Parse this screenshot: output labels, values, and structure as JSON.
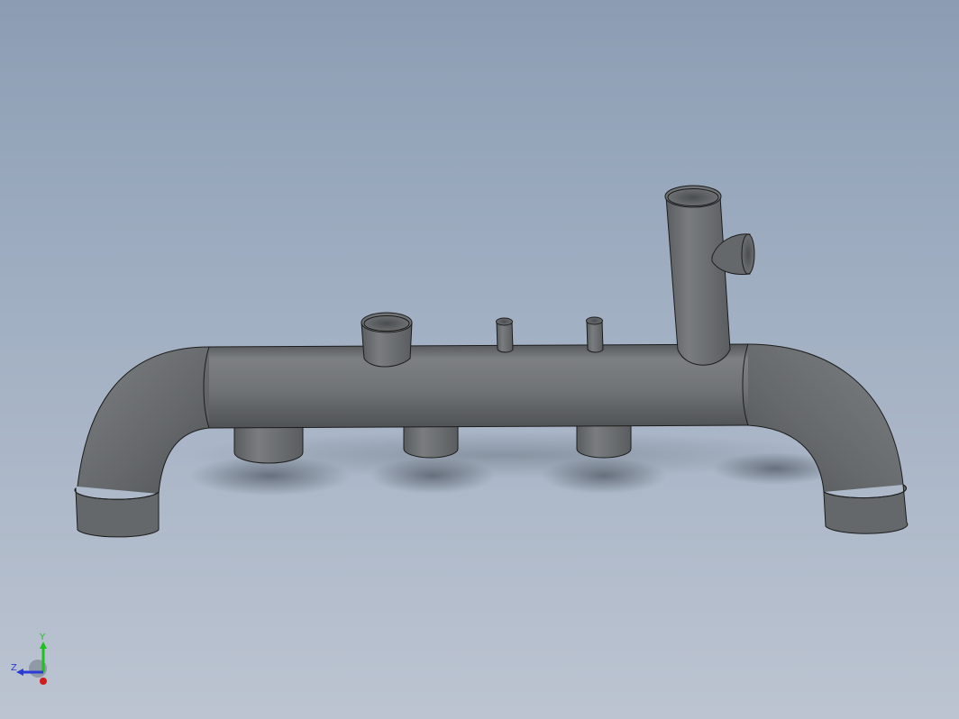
{
  "viewport": {
    "background_top": "#8c9db3",
    "background_bottom": "#bcc4d1"
  },
  "model": {
    "pipe_color": "#6b6e70",
    "pipe_highlight": "#8a8d8f",
    "edge_color": "#1c1c1c"
  },
  "triad": {
    "y_label": "Y",
    "z_label": "Z",
    "y_color": "#1ec21e",
    "z_color": "#2b3bd6",
    "x_color": "#d11c1c"
  }
}
